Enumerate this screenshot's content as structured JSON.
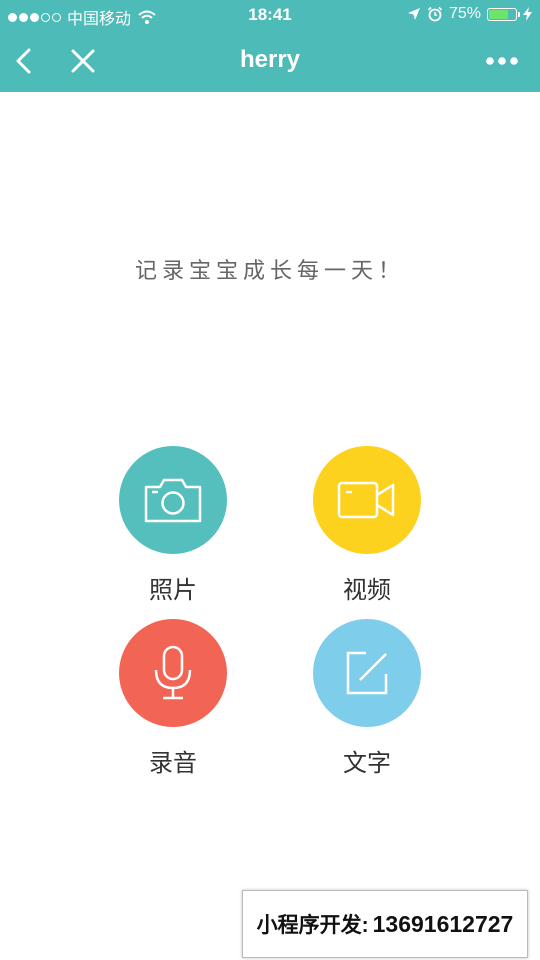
{
  "status_bar": {
    "carrier": "中国移动",
    "time": "18:41",
    "battery_percent": "75%",
    "battery_level": 0.75,
    "signal_dots": 5,
    "signal_filled": 3,
    "battery_fill_color": "#6ee36e"
  },
  "nav": {
    "title": "herry",
    "back_icon": "chevron-left-icon",
    "close_icon": "close-icon",
    "more_icon": "more-dots-icon",
    "background": "#4dbbb8"
  },
  "slogan": "记录宝宝成长每一天！",
  "actions": [
    {
      "label": "照片",
      "icon": "camera-icon",
      "color": "#54bfbd"
    },
    {
      "label": "视频",
      "icon": "video-camera-icon",
      "color": "#fdd21f"
    },
    {
      "label": "录音",
      "icon": "microphone-icon",
      "color": "#f26453"
    },
    {
      "label": "文字",
      "icon": "edit-icon",
      "color": "#7ecdeb"
    }
  ],
  "watermark": {
    "label": "小程序开发:",
    "phone": "13691612727"
  }
}
